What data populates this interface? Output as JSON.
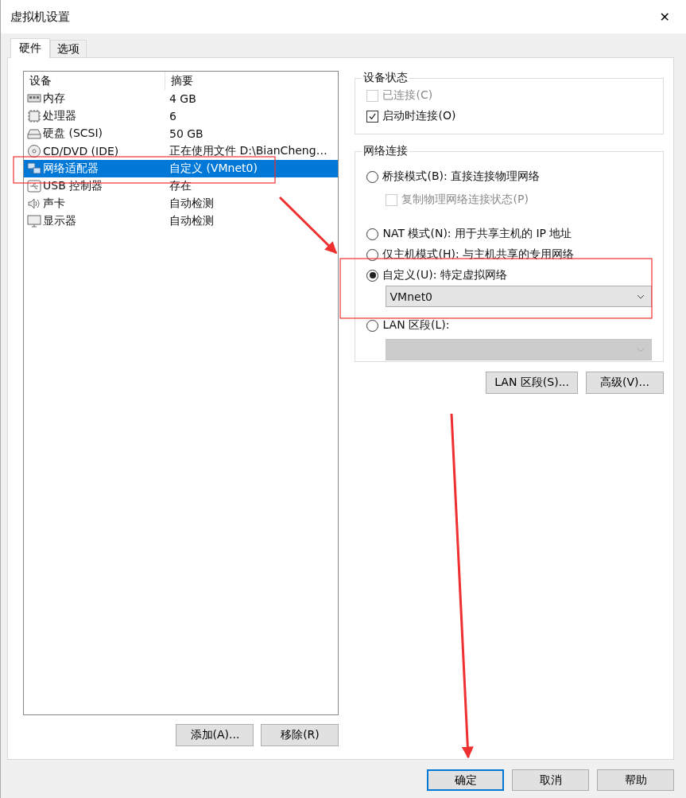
{
  "window": {
    "title": "虚拟机设置",
    "close": "✕"
  },
  "tabs": [
    {
      "label": "硬件",
      "selected": true
    },
    {
      "label": "选项",
      "selected": false
    }
  ],
  "device_list": {
    "columns": [
      "设备",
      "摘要"
    ],
    "rows": [
      {
        "kind": "memory",
        "device": "内存",
        "summary": "4 GB",
        "selected": false
      },
      {
        "kind": "cpu",
        "device": "处理器",
        "summary": "6",
        "selected": false
      },
      {
        "kind": "disk",
        "device": "硬盘 (SCSI)",
        "summary": "50 GB",
        "selected": false
      },
      {
        "kind": "cd",
        "device": "CD/DVD (IDE)",
        "summary": "正在使用文件 D:\\BianCheng…",
        "selected": false
      },
      {
        "kind": "network",
        "device": "网络适配器",
        "summary": "自定义 (VMnet0)",
        "selected": true
      },
      {
        "kind": "usb",
        "device": "USB 控制器",
        "summary": "存在",
        "selected": false
      },
      {
        "kind": "sound",
        "device": "声卡",
        "summary": "自动检测",
        "selected": false
      },
      {
        "kind": "display",
        "device": "显示器",
        "summary": "自动检测",
        "selected": false
      }
    ]
  },
  "list_buttons": [
    "添加(A)...",
    "移除(R)"
  ],
  "device_status": {
    "title": "设备状态",
    "options": [
      {
        "label": "已连接(C)",
        "checked": false,
        "disabled": true
      },
      {
        "label": "启动时连接(O)",
        "checked": true,
        "disabled": false
      }
    ]
  },
  "network_connection": {
    "title": "网络连接",
    "options": [
      {
        "label": "桥接模式(B): 直接连接物理网络",
        "selected": false,
        "checkbox": {
          "label": "复制物理网络连接状态(P)",
          "checked": false,
          "disabled": true
        }
      },
      {
        "label": "NAT 模式(N): 用于共享主机的 IP 地址",
        "selected": false
      },
      {
        "label": "仅主机模式(H): 与主机共享的专用网络",
        "selected": false
      },
      {
        "label": "自定义(U): 特定虚拟网络",
        "selected": true,
        "dropdown": {
          "value": "VMnet0",
          "disabled": false
        }
      },
      {
        "label": "LAN 区段(L):",
        "selected": false,
        "dropdown": {
          "disabled": true
        }
      }
    ]
  },
  "network_buttons": [
    "LAN 区段(S)...",
    "高级(V)..."
  ],
  "dialog_buttons": [
    {
      "label": "确定",
      "default": true
    },
    {
      "label": "取消",
      "default": false
    },
    {
      "label": "帮助",
      "default": false
    }
  ]
}
